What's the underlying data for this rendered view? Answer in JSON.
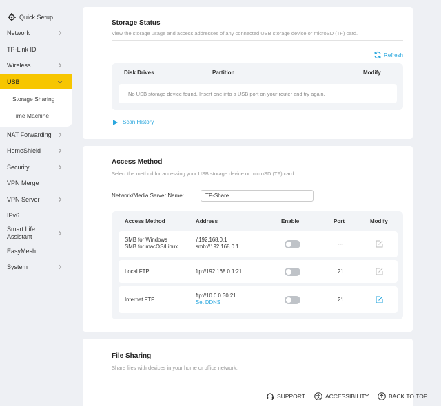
{
  "sidebar": {
    "quick_setup": "Quick Setup",
    "items": [
      {
        "label": "Network"
      },
      {
        "label": "TP-Link ID"
      },
      {
        "label": "Wireless"
      },
      {
        "label": "USB"
      },
      {
        "label": "NAT Forwarding"
      },
      {
        "label": "HomeShield"
      },
      {
        "label": "Security"
      },
      {
        "label": "VPN Merge"
      },
      {
        "label": "VPN Server"
      },
      {
        "label": "IPv6"
      },
      {
        "label": "Smart Life Assistant"
      },
      {
        "label": "EasyMesh"
      },
      {
        "label": "System"
      }
    ],
    "usb_sub": [
      "Storage Sharing",
      "Time Machine"
    ],
    "active_color": "#f7c600"
  },
  "storage": {
    "title": "Storage Status",
    "desc": "View the storage usage and access addresses of any connected USB storage device or microSD (TF) card.",
    "refresh": "Refresh",
    "columns": [
      "Disk Drives",
      "Partition",
      "Modify"
    ],
    "empty": "No USB storage device found. Insert one into a USB port on your router and try again.",
    "scan": "Scan History"
  },
  "access": {
    "title": "Access Method",
    "desc": "Select the method for accessing your USB storage device or microSD (TF) card.",
    "server_name_label": "Network/Media Server Name:",
    "server_name_value": "TP-Share",
    "columns": [
      "Access Method",
      "Address",
      "Enable",
      "Port",
      "Modify"
    ],
    "rows": [
      {
        "method": [
          "SMB for Windows",
          "SMB for macOS/Linux"
        ],
        "address": [
          "\\\\192.168.0.1",
          "smb://192.168.0.1"
        ],
        "port": "---",
        "enabled": false
      },
      {
        "method": [
          "Local FTP"
        ],
        "address": [
          "ftp://192.168.0.1:21"
        ],
        "port": "21",
        "enabled": false
      },
      {
        "method": [
          "Internet FTP"
        ],
        "address": [
          "ftp://10.0.0.30:21"
        ],
        "link": "Set DDNS",
        "port": "21",
        "enabled": false
      }
    ]
  },
  "file_sharing": {
    "title": "File Sharing",
    "desc": "Share files with devices in your home or office network."
  },
  "footer": {
    "support": "SUPPORT",
    "accessibility": "ACCESSIBILITY",
    "back_to_top": "BACK TO TOP"
  },
  "accent_color": "#2aa7de"
}
